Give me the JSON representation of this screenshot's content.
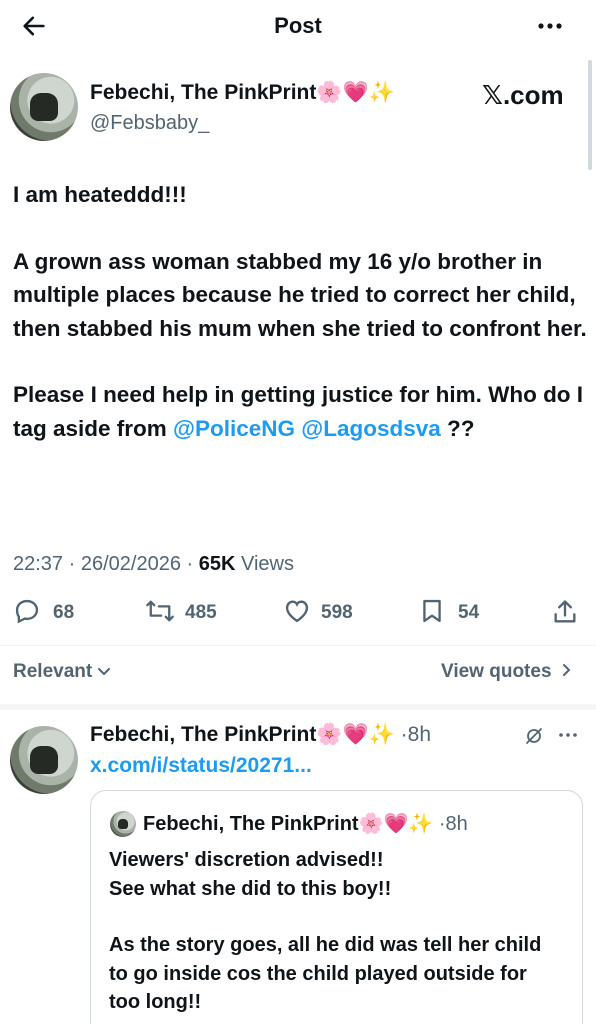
{
  "header": {
    "title": "Post",
    "back_icon": "arrow-left-icon",
    "more_icon": "more-dots-icon"
  },
  "post": {
    "author_name": "Febechi, The PinkPrint",
    "author_handle": "@Febsbaby_",
    "emojis": "🌸💗✨",
    "watermark": "𝕏.com",
    "line1": "I am heateddd!!!",
    "para2": "A grown ass woman stabbed my 16 y/o brother in multiple places because he tried to correct her child, then stabbed his mum when she tried to confront her.",
    "para3_text": "Please I need help in getting justice for him. Who do I tag aside from ",
    "mention1": "@PoliceNG",
    "mention2": "@Lagosdsva",
    "para3_end": " ??",
    "time": "22:37",
    "date": "26/02/2026",
    "views_count": "65K",
    "views_label": "Views",
    "replies": "68",
    "reposts": "485",
    "likes": "598",
    "bookmarks": "54"
  },
  "filter": {
    "sort_label": "Relevant",
    "view_quotes": "View quotes"
  },
  "reply": {
    "author_name": "Febechi, The PinkPrint",
    "emojis": "🌸💗✨",
    "time": "8h",
    "link": "x.com/i/status/20271...",
    "quote": {
      "author_name": "Febechi, The PinkPrint",
      "emojis": "🌸💗✨",
      "time": "8h",
      "line1": "Viewers' discretion advised!!",
      "line2": "See what she did to this boy!!",
      "para2": "As the story goes, all he did was tell her child to go inside cos the child played outside for too long!!"
    }
  },
  "colors": {
    "link": "#1d9bf0",
    "secondary": "#536471",
    "text": "#0f1419"
  }
}
